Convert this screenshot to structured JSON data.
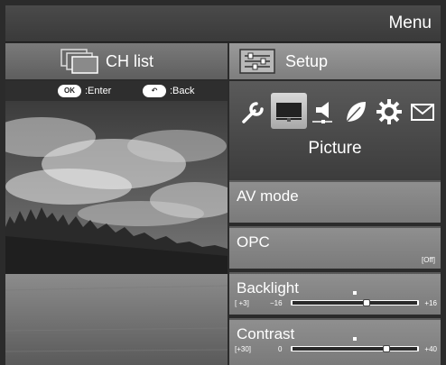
{
  "header": {
    "title": "Menu"
  },
  "tabs": [
    {
      "label": "CH list",
      "icon": "channel-list-icon",
      "selected": false
    },
    {
      "label": "Setup",
      "icon": "setup-icon",
      "selected": true
    }
  ],
  "hints": [
    {
      "key": "OK",
      "action": ":Enter"
    },
    {
      "key": "↶",
      "action": ":Back"
    }
  ],
  "categories": {
    "icons": [
      "wrench-icon",
      "picture-icon",
      "audio-icon",
      "eco-leaf-icon",
      "gear-icon",
      "mail-icon"
    ],
    "selected": "picture-icon",
    "selected_label": "Picture"
  },
  "settings": [
    {
      "label": "AV mode"
    },
    {
      "label": "OPC",
      "value": "[Off]"
    },
    {
      "label": "Backlight",
      "value": "[  +3]",
      "min": "−16",
      "max": "+16",
      "current": 3,
      "range": [
        -16,
        16
      ]
    },
    {
      "label": "Contrast",
      "value": "[+30]",
      "min": "0",
      "max": "+40",
      "current": 30,
      "range": [
        0,
        40
      ]
    }
  ],
  "colors": {
    "panel_bg": "#2b2b2b",
    "tab_selected": "#8e8e8e",
    "row_bg": "#858585",
    "text": "#ffffff"
  }
}
